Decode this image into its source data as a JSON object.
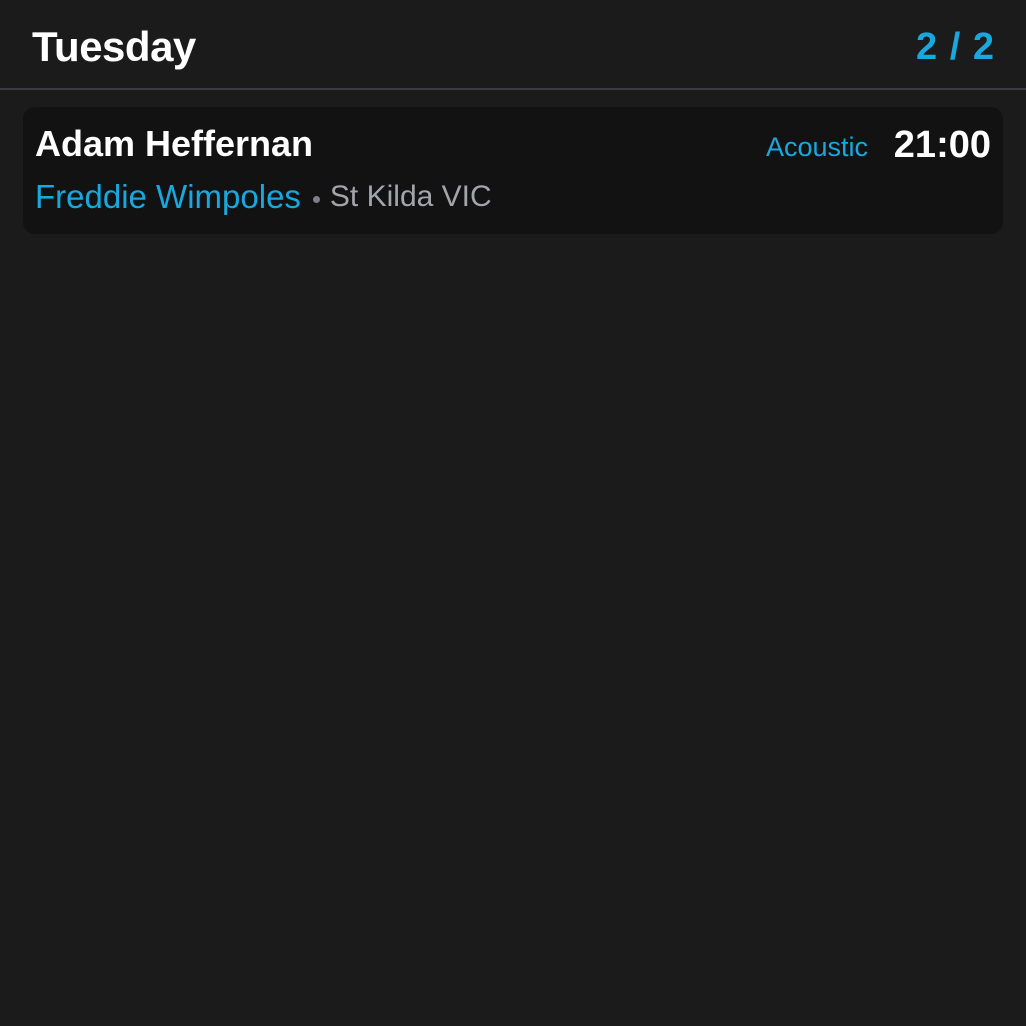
{
  "header": {
    "day": "Tuesday",
    "page_indicator": "2 / 2"
  },
  "gigs": [
    {
      "artist": "Adam Heffernan",
      "genre": "Acoustic",
      "time": "21:00",
      "venue": "Freddie Wimpoles",
      "location": "St Kilda VIC"
    }
  ],
  "colors": {
    "background": "#1b1b1b",
    "card": "#121212",
    "accent": "#18a8de",
    "divider": "#3a3b40",
    "text_primary": "#ffffff",
    "text_secondary": "#a3a5ab"
  }
}
